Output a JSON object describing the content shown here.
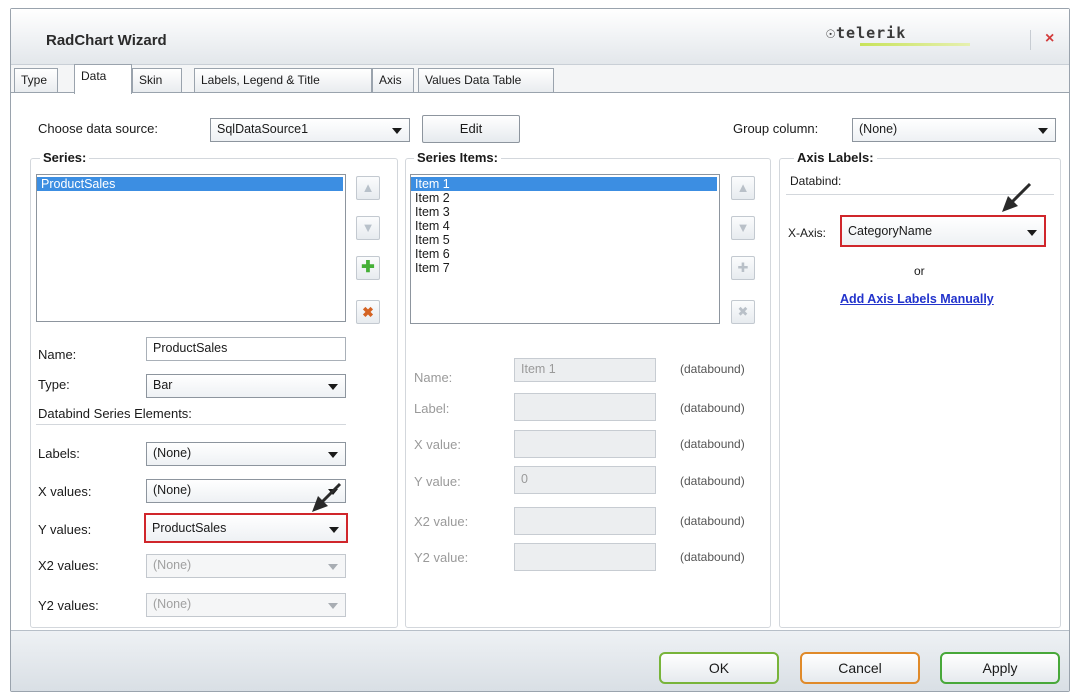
{
  "window": {
    "title": "RadChart Wizard",
    "brand": "telerik",
    "close_glyph": "×"
  },
  "tabs": [
    {
      "label": "Type"
    },
    {
      "label": "Data",
      "active": true
    },
    {
      "label": "Skin"
    },
    {
      "label": "Labels, Legend & Title"
    },
    {
      "label": "Axis"
    },
    {
      "label": "Values Data Table"
    }
  ],
  "top": {
    "datasource_label": "Choose data source:",
    "datasource_value": "SqlDataSource1",
    "edit_label": "Edit",
    "group_column_label": "Group column:",
    "group_column_value": "(None)"
  },
  "series": {
    "title": "Series:",
    "items": [
      "ProductSales"
    ],
    "name_label": "Name:",
    "name_value": "ProductSales",
    "type_label": "Type:",
    "type_value": "Bar",
    "databind_label": "Databind Series Elements:",
    "labels_label": "Labels:",
    "labels_value": "(None)",
    "xvalues_label": "X values:",
    "xvalues_value": "(None)",
    "yvalues_label": "Y values:",
    "yvalues_value": "ProductSales",
    "x2values_label": "X2 values:",
    "x2values_value": "(None)",
    "y2values_label": "Y2 values:",
    "y2values_value": "(None)"
  },
  "series_items": {
    "title": "Series Items:",
    "items": [
      "Item 1",
      "Item 2",
      "Item 3",
      "Item 4",
      "Item 5",
      "Item 6",
      "Item 7"
    ],
    "name_label": "Name:",
    "name_value": "Item 1",
    "label_label": "Label:",
    "xvalue_label": "X value:",
    "yvalue_label": "Y value:",
    "yvalue_value": "0",
    "x2value_label": "X2 value:",
    "y2value_label": "Y2 value:",
    "databound_text": "(databound)"
  },
  "axis_labels": {
    "title": "Axis Labels:",
    "databind_label": "Databind:",
    "xaxis_label": "X-Axis:",
    "xaxis_value": "CategoryName",
    "or_text": "or",
    "manual_link": "Add Axis Labels Manually"
  },
  "footer": {
    "ok_label": "OK",
    "cancel_label": "Cancel",
    "apply_label": "Apply"
  },
  "colors": {
    "highlight": "#d0262b",
    "selection": "#3c8ee2",
    "link": "#2233cc",
    "ok_border": "#78b43a",
    "cancel_border": "#e08a2a",
    "apply_border": "#48a83a"
  },
  "icons": [
    "move-up-icon",
    "move-down-icon",
    "add-icon",
    "delete-icon",
    "dropdown-arrow-icon",
    "pointer-arrow-icon",
    "close-icon"
  ]
}
